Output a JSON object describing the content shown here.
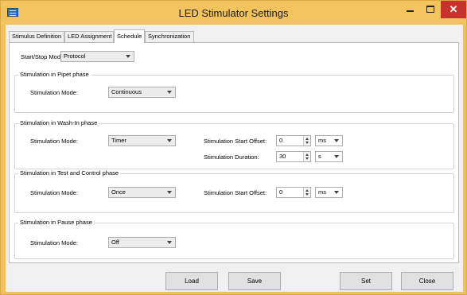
{
  "window": {
    "title": "LED Stimulator Settings"
  },
  "tabs": [
    {
      "label": "Stimulus Definition"
    },
    {
      "label": "LED Assignment"
    },
    {
      "label": "Schedule"
    },
    {
      "label": "Synchronization"
    }
  ],
  "schedule": {
    "start_stop_label": "Start/Stop Mode:",
    "start_stop_value": "Protocol",
    "groups": {
      "pipet": {
        "title": "Stimulation in Pipet phase",
        "mode_label": "Stimulation Mode:",
        "mode_value": "Continuous"
      },
      "washin": {
        "title": "Stimulation in Wash-In phase",
        "mode_label": "Stimulation Mode:",
        "mode_value": "Timer",
        "offset_label": "Stimulation Start Offset:",
        "offset_value": "0",
        "offset_unit": "ms",
        "duration_label": "Stimulation Duration:",
        "duration_value": "30",
        "duration_unit": "s"
      },
      "test": {
        "title": "Stimulation in Test and Control phase",
        "mode_label": "Stimulation Mode:",
        "mode_value": "Once",
        "offset_label": "Stimulation Start Offset:",
        "offset_value": "0",
        "offset_unit": "ms"
      },
      "pause": {
        "title": "Stimulation in Pause phase",
        "mode_label": "Stimulation Mode:",
        "mode_value": "Off"
      }
    }
  },
  "footer": {
    "load_label": "Load",
    "save_label": "Save",
    "set_label": "Set",
    "close_label": "Close"
  },
  "colors": {
    "frame": "#f0c15c",
    "close_button": "#c7332c",
    "panel": "#ffffff",
    "client": "#f0f0f0"
  }
}
